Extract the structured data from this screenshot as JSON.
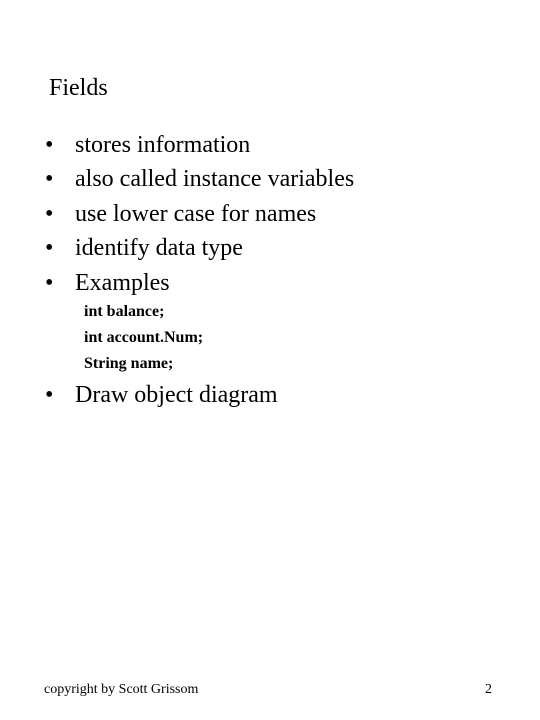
{
  "slide": {
    "title": "Fields",
    "bullets": [
      "stores information",
      "also called instance variables",
      "use lower case for names",
      "identify data type",
      "Examples"
    ],
    "bullet_symbol": "•",
    "code_examples": [
      "int balance;",
      "int account.Num;",
      "String name;"
    ],
    "extra_bullet": "Draw object diagram"
  },
  "footer": {
    "copyright": "copyright by Scott Grissom",
    "page_number": "2"
  }
}
